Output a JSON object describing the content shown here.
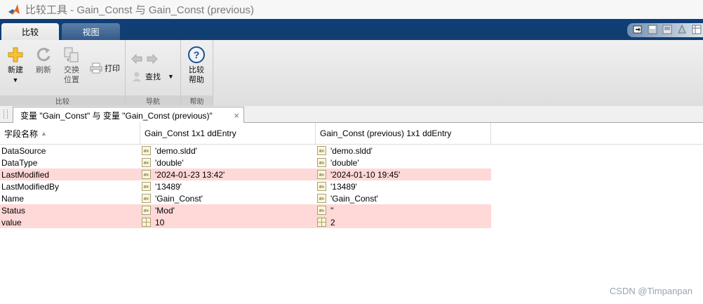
{
  "window": {
    "title": "比较工具 - Gain_Const 与 Gain_Const (previous)"
  },
  "ribbon": {
    "tabs": [
      {
        "label": "比较",
        "active": true
      },
      {
        "label": "视图",
        "active": false
      }
    ],
    "sections": {
      "compare": {
        "label": "比较",
        "new_label": "新建",
        "refresh_label": "刷新",
        "swap_label_1": "交换",
        "swap_label_2": "位置",
        "print_label": "打印"
      },
      "navigate": {
        "label": "导航",
        "find_label": "查找"
      },
      "help": {
        "label": "帮助",
        "help_label_1": "比较",
        "help_label_2": "帮助"
      }
    }
  },
  "document_tab": {
    "label": "变量 \"Gain_Const\" 与 变量 \"Gain_Const (previous)\"",
    "close": "×"
  },
  "table": {
    "columns": [
      "字段名称",
      "Gain_Const 1x1 ddEntry",
      "Gain_Const (previous) 1x1 ddEntry"
    ],
    "sort_indicator": "▲",
    "rows": [
      {
        "field": "DataSource",
        "left": "'demo.sldd'",
        "right": "'demo.sldd'",
        "type": "text",
        "diff": false
      },
      {
        "field": "DataType",
        "left": "'double'",
        "right": "'double'",
        "type": "text",
        "diff": false
      },
      {
        "field": "LastModified",
        "left": "'2024-01-23 13:42'",
        "right": "'2024-01-10 19:45'",
        "type": "text",
        "diff": true
      },
      {
        "field": "LastModifiedBy",
        "left": "'13489'",
        "right": "'13489'",
        "type": "text",
        "diff": false
      },
      {
        "field": "Name",
        "left": "'Gain_Const'",
        "right": "'Gain_Const'",
        "type": "text",
        "diff": false
      },
      {
        "field": "Status",
        "left": "'Mod'",
        "right": "''",
        "type": "text",
        "diff": true
      },
      {
        "field": "value",
        "left": "10",
        "right": "2",
        "type": "numeric",
        "diff": true
      }
    ]
  },
  "watermark": "CSDN @Timpanpan",
  "colors": {
    "diff_row": "#ffd8d8",
    "ribbon_blue": "#123e6f"
  }
}
